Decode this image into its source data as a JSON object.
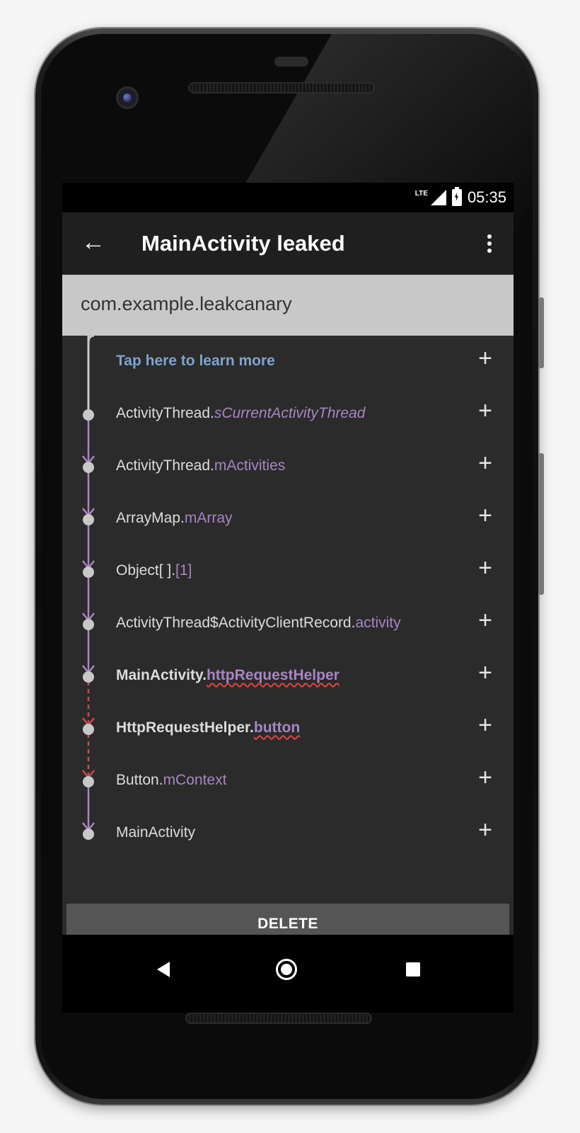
{
  "statusbar": {
    "network": "LTE",
    "time": "05:35"
  },
  "appbar": {
    "title": "MainActivity leaked"
  },
  "package": "com.example.leakcanary",
  "learn_more": "Tap here to learn more",
  "trace": [
    {
      "class": "ActivityThread.",
      "field": "sCurrentActivityThread",
      "italic": true,
      "bold": false,
      "leak": false
    },
    {
      "class": "ActivityThread.",
      "field": "mActivities",
      "italic": false,
      "bold": false,
      "leak": false
    },
    {
      "class": "ArrayMap.",
      "field": "mArray",
      "italic": false,
      "bold": false,
      "leak": false
    },
    {
      "class": "Object[ ].",
      "field": "[1]",
      "italic": false,
      "bold": false,
      "leak": false
    },
    {
      "class": "ActivityThread$ActivityClientRecord.",
      "field": "activity",
      "italic": false,
      "bold": false,
      "leak": false
    },
    {
      "class": "MainActivity.",
      "field": "httpRequestHelper",
      "italic": false,
      "bold": true,
      "leak": true
    },
    {
      "class": "HttpRequestHelper.",
      "field": "button",
      "italic": false,
      "bold": true,
      "leak": true
    },
    {
      "class": "Button.",
      "field": "mContext",
      "italic": false,
      "bold": false,
      "leak": false
    },
    {
      "class": "MainActivity",
      "field": "",
      "italic": false,
      "bold": false,
      "leak": false
    }
  ],
  "delete_label": "DELETE",
  "colors": {
    "field": "#a985c4",
    "link": "#7ea4cf",
    "tree_line": "#a985c4",
    "leak_line": "#d04848",
    "node": "#c8c8c8"
  }
}
